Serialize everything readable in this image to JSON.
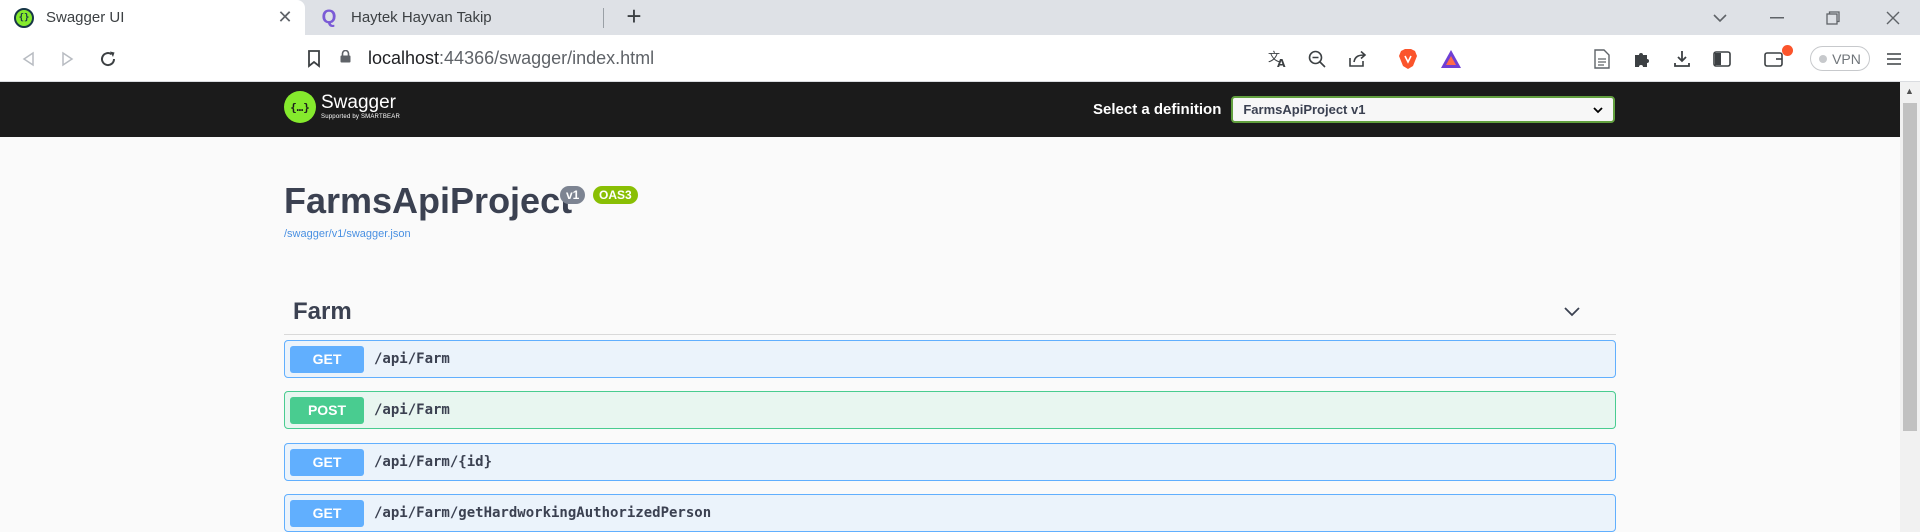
{
  "browser": {
    "tabs": [
      {
        "title": "Swagger UI",
        "active": true
      },
      {
        "title": "Haytek Hayvan Takip",
        "active": false
      }
    ],
    "address": {
      "host": "localhost",
      "path": ":44366/swagger/index.html"
    },
    "vpn_label": "VPN"
  },
  "swagger": {
    "logo_name": "Swagger",
    "logo_support": "Supported by SMARTBEAR",
    "definition_label": "Select a definition",
    "definition_value": "FarmsApiProject v1",
    "title": "FarmsApiProject",
    "version_badge": "v1",
    "oas_badge": "OAS3",
    "json_link": "/swagger/v1/swagger.json",
    "tag": "Farm",
    "operations": [
      {
        "method": "GET",
        "path": "/api/Farm"
      },
      {
        "method": "POST",
        "path": "/api/Farm"
      },
      {
        "method": "GET",
        "path": "/api/Farm/{id}"
      },
      {
        "method": "GET",
        "path": "/api/Farm/getHardworkingAuthorizedPerson"
      }
    ]
  },
  "colors": {
    "get": "#61affe",
    "post": "#49cc90",
    "topbar": "#1b1b1b",
    "accent": "#85ea2d"
  }
}
